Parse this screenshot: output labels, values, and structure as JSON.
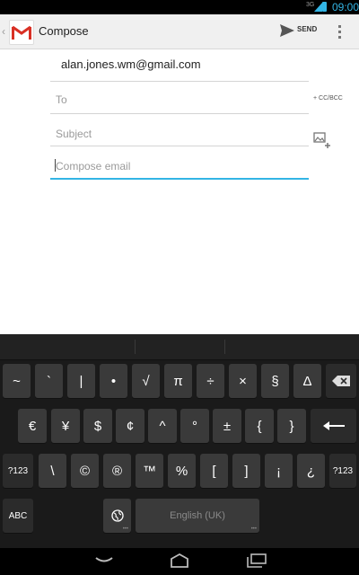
{
  "status_bar": {
    "network": "3G",
    "time": "09:00"
  },
  "action_bar": {
    "title": "Compose",
    "send_label": "SEND",
    "accent": "#33b5e5"
  },
  "compose": {
    "from": "alan.jones.wm@gmail.com",
    "to_placeholder": "To",
    "cc_bcc_label": "+ CC/BCC",
    "subject_placeholder": "Subject",
    "body_placeholder": "Compose email"
  },
  "keyboard": {
    "row1": [
      "~",
      "`",
      "|",
      "•",
      "√",
      "π",
      "÷",
      "×",
      "§",
      "Δ"
    ],
    "row2": [
      "€",
      "¥",
      "$",
      "¢",
      "^",
      "°",
      "±",
      "{",
      "}"
    ],
    "row3_left": "?123",
    "row3": [
      "\\",
      "©",
      "®",
      "™",
      "%",
      "[",
      "]",
      "¡",
      "¿"
    ],
    "row3_right": "?123",
    "row4_left": "ABC",
    "space_label": "English (UK)",
    "key_color": "#3a3a3a"
  }
}
